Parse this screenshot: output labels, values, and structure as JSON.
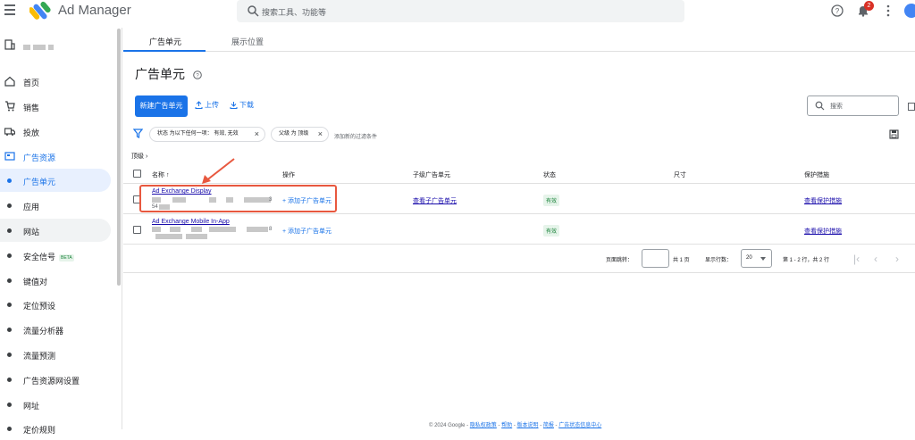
{
  "app": {
    "name": "Ad Manager"
  },
  "topbar": {
    "search_placeholder": "搜索工具、功能等",
    "notification_count": "2"
  },
  "sidebar": {
    "items": [
      {
        "label": "首页",
        "icon": "home-icon"
      },
      {
        "label": "销售",
        "icon": "cart-icon"
      },
      {
        "label": "投放",
        "icon": "truck-icon"
      },
      {
        "label": "广告资源",
        "icon": "inventory-icon"
      },
      {
        "label": "广告单元"
      },
      {
        "label": "应用"
      },
      {
        "label": "网站"
      },
      {
        "label": "安全信号",
        "badge": "BETA"
      },
      {
        "label": "键值对"
      },
      {
        "label": "定位预设"
      },
      {
        "label": "流量分析器"
      },
      {
        "label": "流量预测"
      },
      {
        "label": "广告资源网设置"
      },
      {
        "label": "网址"
      },
      {
        "label": "定价规则"
      }
    ]
  },
  "tabs": [
    {
      "label": "广告单元"
    },
    {
      "label": "展示位置"
    }
  ],
  "page": {
    "title": "广告单元"
  },
  "toolbar": {
    "new_label": "新建广告单元",
    "upload_label": "上传",
    "download_label": "下载",
    "search_placeholder": "搜索"
  },
  "filters": {
    "chip1": "状态 为以下任何一项： 有效, 无效",
    "chip2": "父级 为 顶级",
    "add": "添加新的过滤条件"
  },
  "breadcrumb": "顶级",
  "table": {
    "headers": {
      "name": "名称 ↑",
      "action": "操作",
      "child": "子级广告单元",
      "status": "状态",
      "size": "尺寸",
      "protection": "保护措施"
    },
    "rows": [
      {
        "name": "Ad Exchange Display",
        "code_suffix": "3",
        "code_prefix": "54",
        "action": "+ 添加子广告单元",
        "child": "查看子广告单元",
        "status": "有效",
        "protection": "查看保护措施"
      },
      {
        "name": "Ad Exchange Mobile In-App",
        "code_suffix": "8",
        "action": "+ 添加子广告单元",
        "child": "",
        "status": "有效",
        "protection": "查看保护措施"
      }
    ]
  },
  "pager": {
    "jump_label": "页面跳转：",
    "total_pages": "共 1 页",
    "rows_label": "显示行数：",
    "rows_value": "20",
    "range": "第 1 - 2 行，共 2 行"
  },
  "footer": {
    "copyright": "© 2024 Google -",
    "privacy": "隐私权政策",
    "help": "帮助",
    "release": "版本说明",
    "brief": "简报",
    "status": "广告状态信息中心"
  },
  "colors": {
    "accent": "#1a73e8",
    "annotation": "#e8583f",
    "status_active": "#188038"
  }
}
